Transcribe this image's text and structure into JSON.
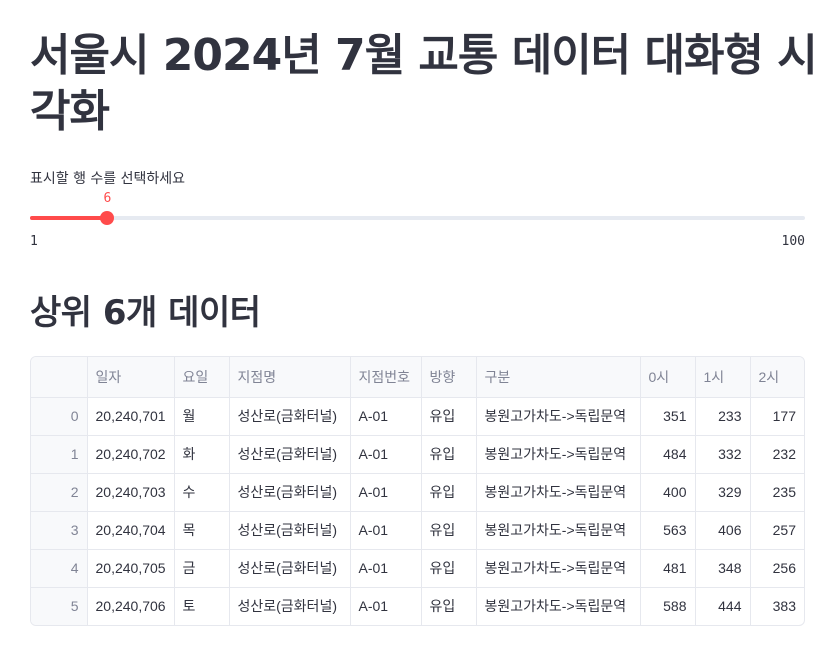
{
  "page": {
    "title": "서울시 2024년 7월 교통 데이터 대화형 시각화",
    "section_title": "상위 6개 데이터"
  },
  "slider": {
    "label": "표시할 행 수를 선택하세요",
    "value": 6,
    "value_label": "6",
    "min": 1,
    "max": 100,
    "min_label": "1",
    "max_label": "100",
    "accent": "#ff4b4b"
  },
  "table": {
    "columns": [
      "",
      "일자",
      "요일",
      "지점명",
      "지점번호",
      "방향",
      "구분",
      "0시",
      "1시",
      "2시"
    ],
    "rows": [
      [
        "0",
        "20,240,701",
        "월",
        "성산로(금화터널)",
        "A-01",
        "유입",
        "봉원고가차도->독립문역",
        "351",
        "233",
        "177"
      ],
      [
        "1",
        "20,240,702",
        "화",
        "성산로(금화터널)",
        "A-01",
        "유입",
        "봉원고가차도->독립문역",
        "484",
        "332",
        "232"
      ],
      [
        "2",
        "20,240,703",
        "수",
        "성산로(금화터널)",
        "A-01",
        "유입",
        "봉원고가차도->독립문역",
        "400",
        "329",
        "235"
      ],
      [
        "3",
        "20,240,704",
        "목",
        "성산로(금화터널)",
        "A-01",
        "유입",
        "봉원고가차도->독립문역",
        "563",
        "406",
        "257"
      ],
      [
        "4",
        "20,240,705",
        "금",
        "성산로(금화터널)",
        "A-01",
        "유입",
        "봉원고가차도->독립문역",
        "481",
        "348",
        "256"
      ],
      [
        "5",
        "20,240,706",
        "토",
        "성산로(금화터널)",
        "A-01",
        "유입",
        "봉원고가차도->독립문역",
        "588",
        "444",
        "383"
      ]
    ]
  }
}
